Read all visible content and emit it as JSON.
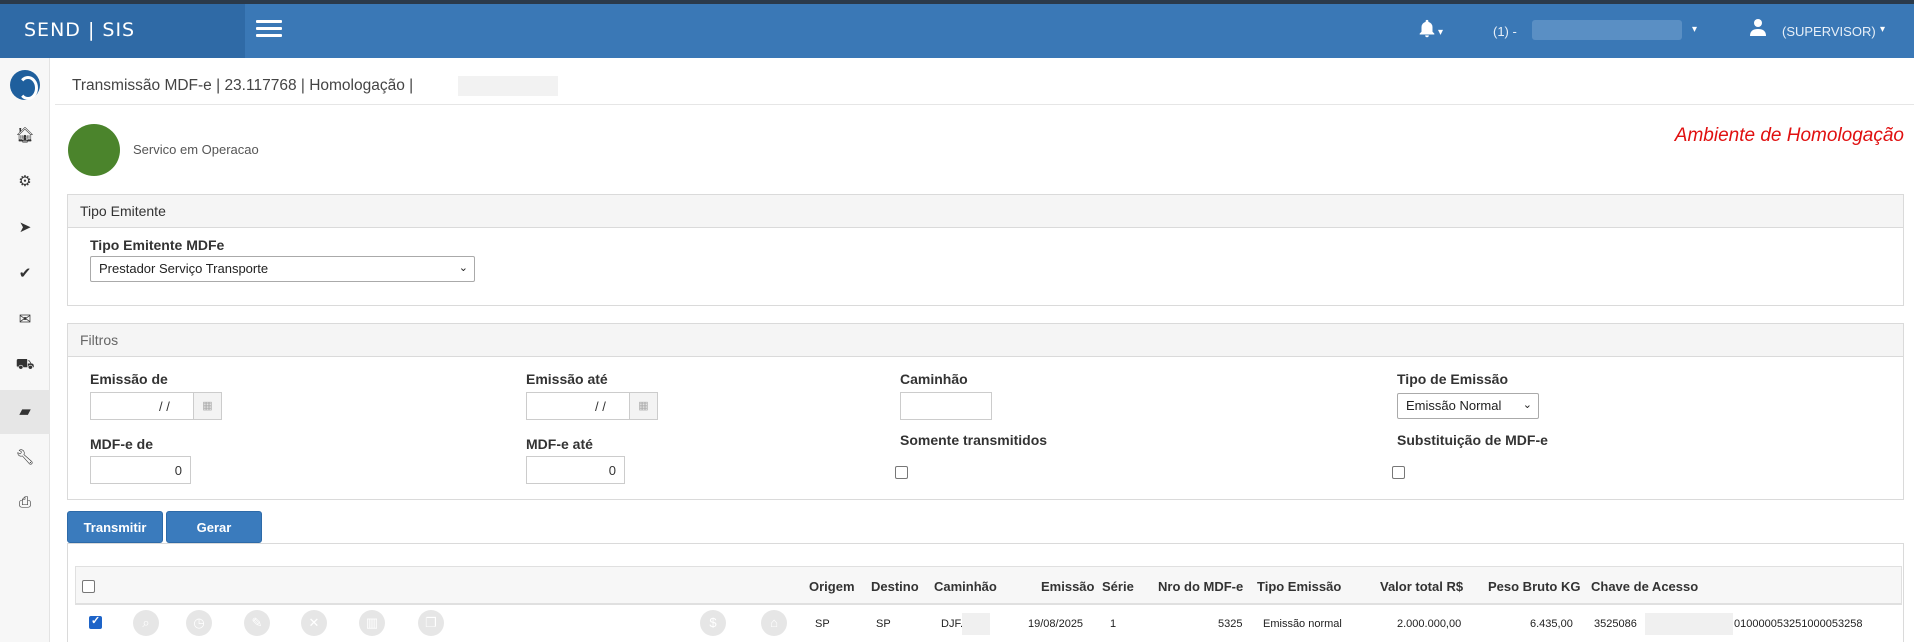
{
  "app": {
    "brand": "SEND | SIS",
    "company_prefix": "(1) -",
    "user": "(SUPERVISOR)"
  },
  "breadcrumb": "Transmissão MDF-e | 23.117768 | Homologação |",
  "service": {
    "status_text": "Servico em Operacao",
    "status_color": "#4b842c",
    "environment": "Ambiente de Homologação",
    "environment_color": "#e01010"
  },
  "tipo_emitente": {
    "panel_title": "Tipo Emitente",
    "label": "Tipo Emitente MDFe",
    "selected": "Prestador Serviço Transporte"
  },
  "filtros": {
    "panel_title": "Filtros",
    "emissao_de": {
      "label": "Emissão de",
      "value": "/ /"
    },
    "emissao_ate": {
      "label": "Emissão até",
      "value": "/ /"
    },
    "caminhao": {
      "label": "Caminhão",
      "value": ""
    },
    "tipo_emissao": {
      "label": "Tipo de Emissão",
      "selected": "Emissão Normal"
    },
    "mdfe_de": {
      "label": "MDF-e de",
      "value": "0"
    },
    "mdfe_ate": {
      "label": "MDF-e até",
      "value": "0"
    },
    "somente_transmitidos": {
      "label": "Somente transmitidos",
      "checked": false
    },
    "substituicao": {
      "label": "Substituição de MDF-e",
      "checked": false
    }
  },
  "actions": {
    "transmitir": "Transmitir",
    "gerar": "Gerar"
  },
  "table": {
    "columns": [
      "Origem",
      "Destino",
      "Caminhão",
      "Emissão",
      "Série",
      "Nro do MDF-e",
      "Tipo Emissão",
      "Valor total R$",
      "Peso Bruto KG",
      "Chave de Acesso"
    ],
    "rows": [
      {
        "checked": true,
        "origem": "SP",
        "destino": "SP",
        "caminhao": "DJF.",
        "emissao": "19/08/2025",
        "serie": "1",
        "nro": "5325",
        "tipo": "Emissão normal",
        "valor": "2.000.000,00",
        "peso": "6.435,00",
        "chave_inicio": "3525086",
        "chave_fim": "01000005325100005325​8"
      }
    ]
  }
}
